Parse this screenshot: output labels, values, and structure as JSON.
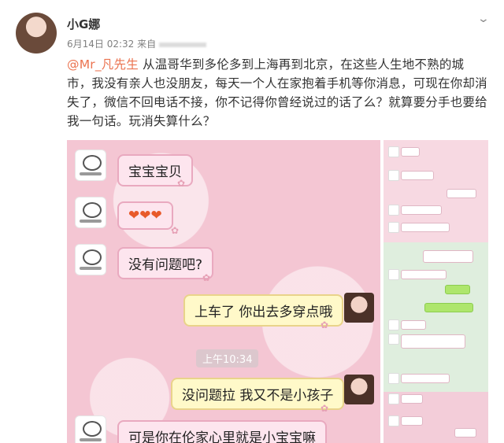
{
  "post": {
    "username": "小G娜",
    "timestamp": "6月14日 02:32",
    "source_prefix": "来自",
    "mention": "@Mr_凡先生",
    "text": " 从温哥华到多伦多到上海再到北京，在这些人生地不熟的城市，我没有亲人也没朋友，每天一个人在家抱着手机等你消息，可现在你却消失了，微信不回电话不接，你不记得你曾经说过的话了么？就算要分手也要给我一句话。玩消失算什么？"
  },
  "chat": {
    "messages": [
      {
        "side": "left",
        "text": "宝宝宝贝"
      },
      {
        "side": "left",
        "text": "❤❤❤"
      },
      {
        "side": "left",
        "text": "没有问题吧?"
      },
      {
        "side": "right",
        "text": "上车了 你出去多穿点哦"
      },
      {
        "side": "right",
        "text": "没问题拉 我又不是小孩子"
      },
      {
        "side": "left",
        "text": "可是你在伦家心里就是小宝宝嘛"
      }
    ],
    "time_chip": "上午10:34"
  },
  "icons": {
    "more": "chevron-down-icon"
  }
}
